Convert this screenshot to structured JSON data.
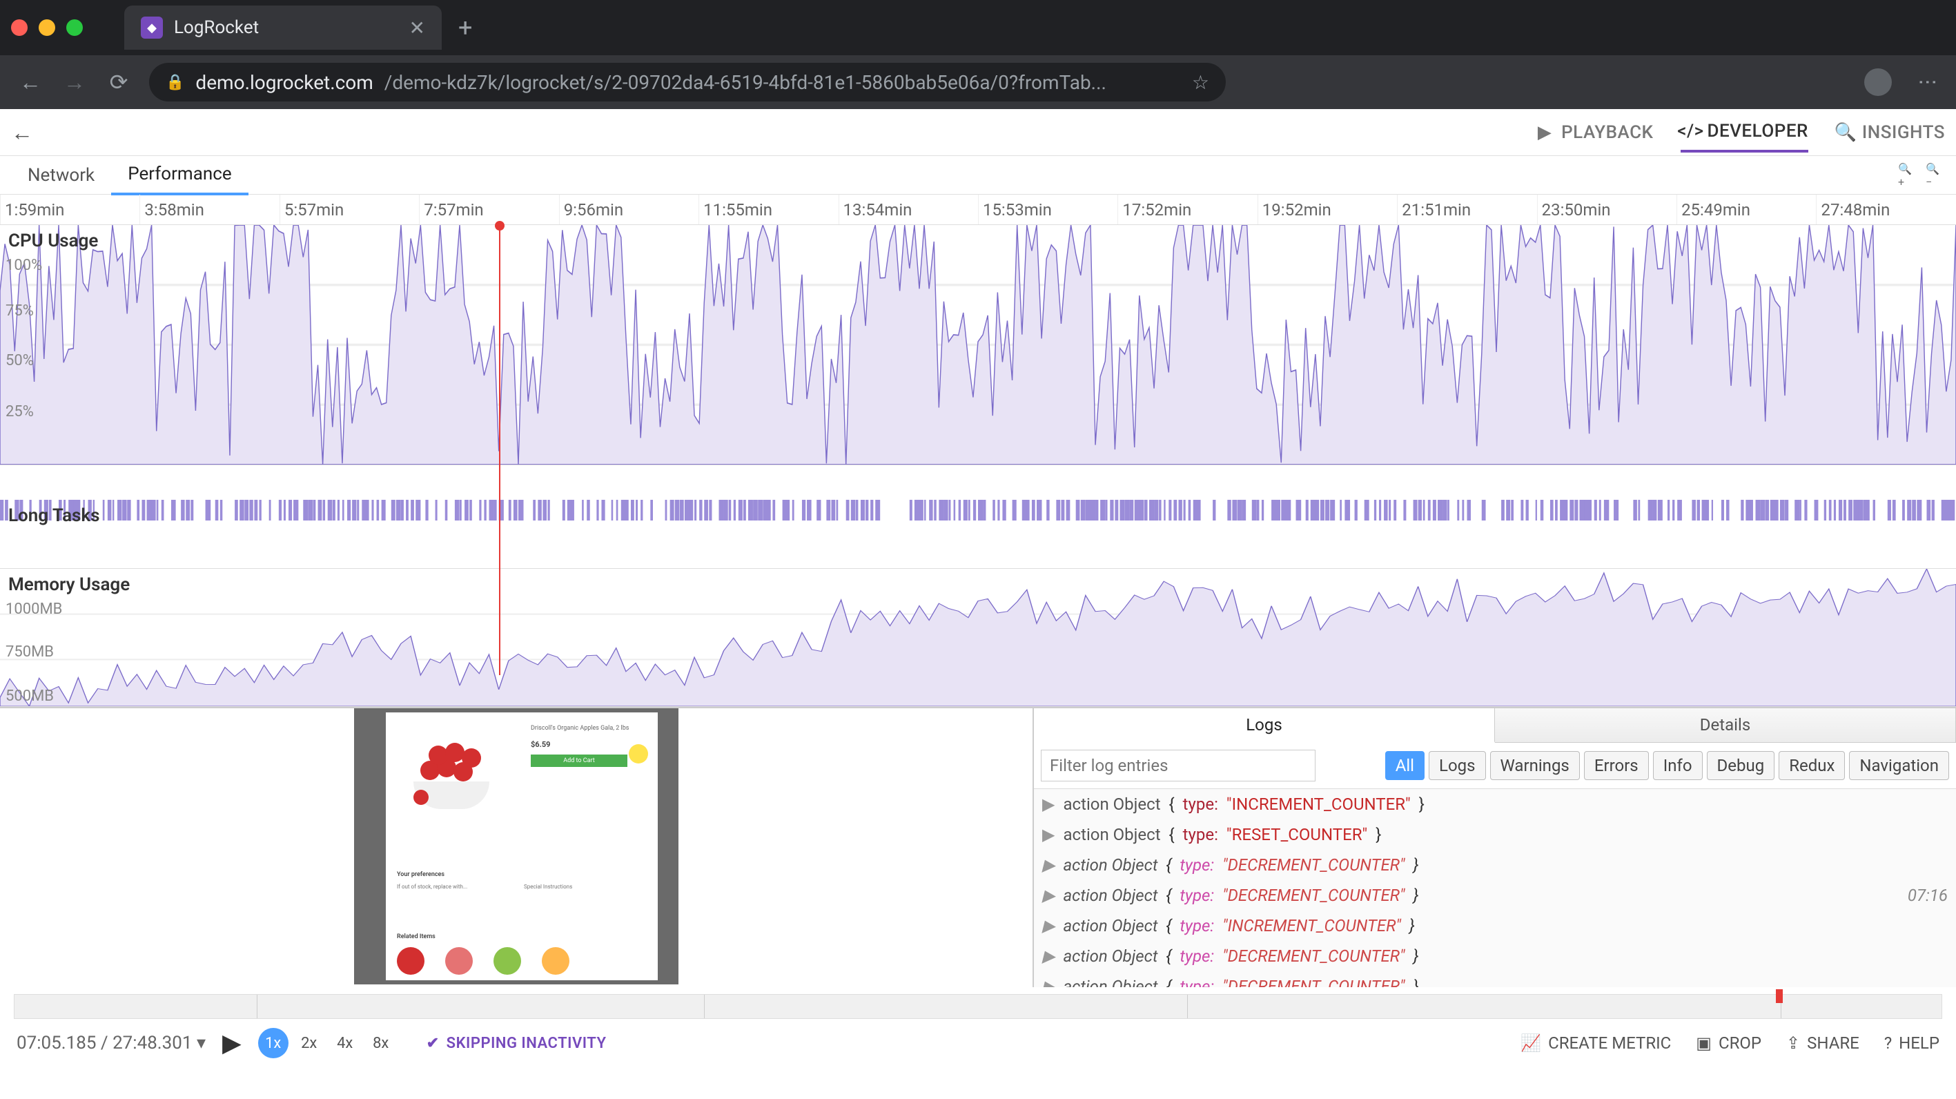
{
  "browser": {
    "tab_title": "LogRocket",
    "url_domain": "demo.logrocket.com",
    "url_path": "/demo-kdz7k/logrocket/s/2-09702da4-6519-4bfd-81e1-5860bab5e06a/0?fromTab..."
  },
  "modes": {
    "playback": "PLAYBACK",
    "developer": "DEVELOPER",
    "insights": "INSIGHTS"
  },
  "sub_tabs": {
    "network": "Network",
    "performance": "Performance"
  },
  "timeline_ticks": [
    "1:59min",
    "3:58min",
    "5:57min",
    "7:57min",
    "9:56min",
    "11:55min",
    "13:54min",
    "15:53min",
    "17:52min",
    "19:52min",
    "21:51min",
    "23:50min",
    "25:49min",
    "27:48min"
  ],
  "sections": {
    "cpu": "CPU Usage",
    "long": "Long Tasks",
    "mem": "Memory Usage"
  },
  "cpu_y": {
    "y100": "100%",
    "y75": "75%",
    "y50": "50%",
    "y25": "25%"
  },
  "mem_y": {
    "y1000": "1000MB",
    "y750": "750MB",
    "y500": "500MB"
  },
  "preview": {
    "product": "Driscoll's Organic Apples Gala, 2 lbs",
    "price": "$6.59",
    "cta": "Add to Cart",
    "prefs": "Your preferences",
    "oos": "If out of stock, replace with...",
    "si": "Special Instructions",
    "related": "Related Items"
  },
  "logs_panel": {
    "tabs": {
      "logs": "Logs",
      "details": "Details"
    },
    "filter_placeholder": "Filter log entries",
    "filters": {
      "all": "All",
      "logs": "Logs",
      "warnings": "Warnings",
      "errors": "Errors",
      "info": "Info",
      "debug": "Debug",
      "redux": "Redux",
      "navigation": "Navigation"
    },
    "entries": [
      {
        "label": "action Object",
        "type": "INCREMENT_COUNTER",
        "italic": false
      },
      {
        "label": "action Object",
        "type": "RESET_COUNTER",
        "italic": false
      },
      {
        "label": "action Object",
        "type": "DECREMENT_COUNTER",
        "italic": true
      },
      {
        "label": "action Object",
        "type": "DECREMENT_COUNTER",
        "italic": true,
        "ts": "07:16"
      },
      {
        "label": "action Object",
        "type": "INCREMENT_COUNTER",
        "italic": true
      },
      {
        "label": "action Object",
        "type": "DECREMENT_COUNTER",
        "italic": true
      },
      {
        "label": "action Object",
        "type": "DECREMENT_COUNTER",
        "italic": true
      }
    ]
  },
  "player": {
    "time": "07:05.185 / 27:48.301",
    "speeds": [
      "1x",
      "2x",
      "4x",
      "8x"
    ],
    "skip": "SKIPPING INACTIVITY",
    "actions": {
      "metric": "CREATE METRIC",
      "crop": "CROP",
      "share": "SHARE",
      "help": "HELP"
    }
  },
  "chart_data": [
    {
      "type": "area",
      "title": "CPU Usage",
      "ylabel": "%",
      "ylim": [
        0,
        100
      ],
      "x": [
        "1:59",
        "3:58",
        "5:57",
        "7:57",
        "9:56",
        "11:55",
        "13:54",
        "15:53",
        "17:52",
        "19:52",
        "21:51",
        "23:50",
        "25:49",
        "27:48"
      ],
      "values": [
        65,
        90,
        55,
        95,
        30,
        85,
        40,
        92,
        35,
        88,
        45,
        90,
        50,
        93,
        42,
        95,
        30,
        85,
        48,
        90,
        52,
        94,
        60,
        92,
        40,
        88
      ]
    },
    {
      "type": "area",
      "title": "Memory Usage",
      "ylabel": "MB",
      "ylim": [
        500,
        1000
      ],
      "x": [
        "1:59",
        "3:58",
        "5:57",
        "7:57",
        "9:56",
        "11:55",
        "13:54",
        "15:53",
        "17:52",
        "19:52",
        "21:51",
        "23:50",
        "25:49",
        "27:48"
      ],
      "values": [
        550,
        600,
        620,
        720,
        640,
        680,
        620,
        700,
        820,
        860,
        840,
        900,
        820,
        860,
        880,
        920,
        860,
        900,
        940,
        900
      ]
    }
  ]
}
